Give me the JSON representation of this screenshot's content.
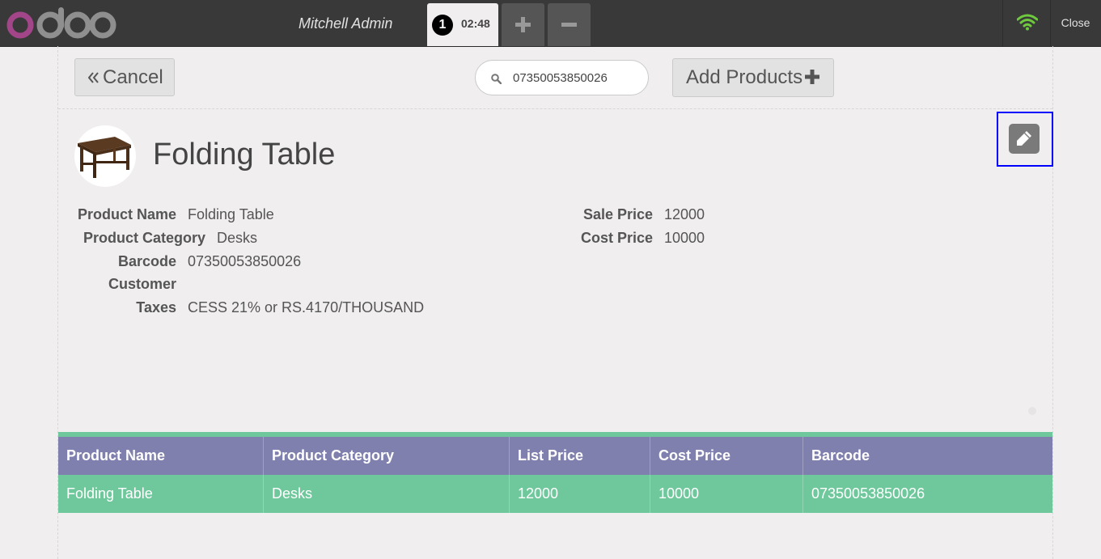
{
  "header": {
    "cashier_name": "Mitchell Admin",
    "order": {
      "number": "1",
      "time": "02:48"
    },
    "close_label": "Close"
  },
  "control_bar": {
    "cancel_label": "Cancel",
    "search_value": "07350053850026",
    "add_products_label": "Add Products"
  },
  "product": {
    "title": "Folding Table",
    "fields_left": [
      {
        "label": "Product Name",
        "value": "Folding Table"
      },
      {
        "label": "Product Category",
        "value": "Desks"
      },
      {
        "label": "Barcode",
        "value": "07350053850026"
      },
      {
        "label": "Customer",
        "value": ""
      },
      {
        "label": "Taxes",
        "value": "CESS 21% or RS.4170/THOUSAND"
      }
    ],
    "fields_right": [
      {
        "label": "Sale Price",
        "value": "12000"
      },
      {
        "label": "Cost Price",
        "value": "10000"
      }
    ]
  },
  "table": {
    "columns": [
      "Product Name",
      "Product Category",
      "List Price",
      "Cost Price",
      "Barcode"
    ],
    "rows": [
      [
        "Folding Table",
        "Desks",
        "12000",
        "10000",
        "07350053850026"
      ]
    ]
  },
  "colors": {
    "topbar": "#393939",
    "table_header": "#8080ae",
    "table_row": "#6ec89b",
    "focus_outline": "#0000ff",
    "wifi": "#6ec93e"
  }
}
